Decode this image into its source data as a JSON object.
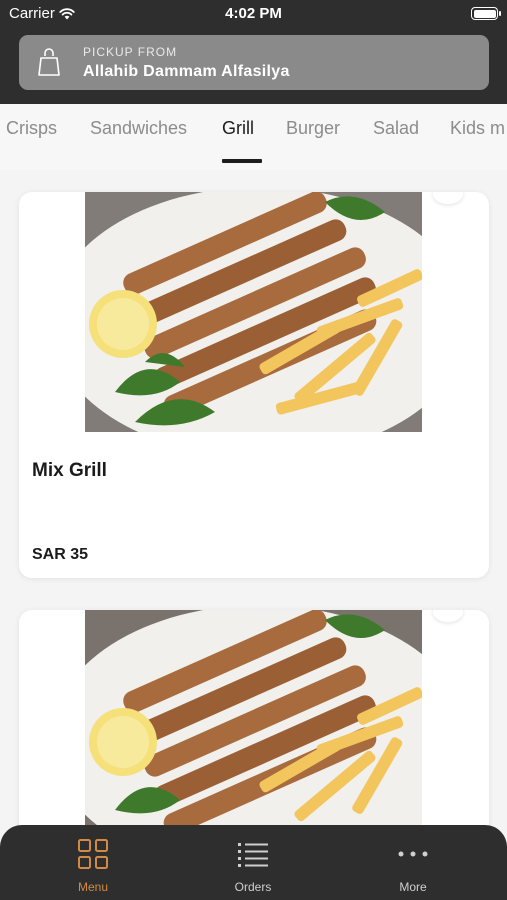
{
  "status_bar": {
    "carrier": "Carrier",
    "time": "4:02 PM",
    "battery_level": 1.0
  },
  "pickup": {
    "label": "PICKUP FROM",
    "location": "Allahib Dammam Alfasilya"
  },
  "categories": {
    "items": [
      "Crisps",
      "Sandwiches",
      "Grill",
      "Burger",
      "Salad",
      "Kids m"
    ],
    "active": "Grill"
  },
  "products": [
    {
      "name": "Mix Grill",
      "price": "SAR 35"
    },
    {
      "name": "",
      "price": ""
    }
  ],
  "tabbar": {
    "items": [
      {
        "label": "Menu",
        "icon": "grid-icon",
        "active": true
      },
      {
        "label": "Orders",
        "icon": "list-icon",
        "active": false
      },
      {
        "label": "More",
        "icon": "more-dots-icon",
        "active": false
      }
    ]
  },
  "colors": {
    "header_bg": "#2e2e2e",
    "accent": "#d28b45",
    "card_bg": "#ffffff",
    "page_bg": "#f4f4f4"
  }
}
